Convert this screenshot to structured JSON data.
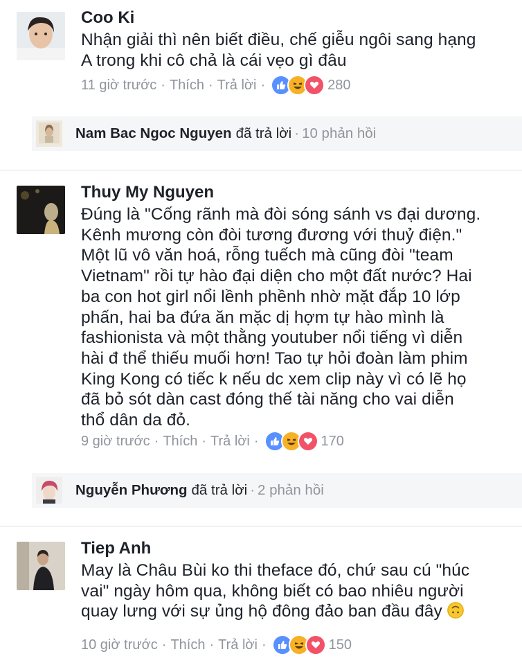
{
  "comments": [
    {
      "name": "Coo Ki",
      "lines": [
        "Nhận giải thì nên biết điều, chế giễu ngôi sang hạng",
        "A trong khi cô chả là cái vẹo gì đâu"
      ],
      "time": "11 giờ trước",
      "like": "Thích",
      "reply": "Trả lời",
      "reaction_count": "280",
      "replies": {
        "name": "Nam Bac Ngoc Nguyen",
        "action": "đã trả lời",
        "count": "10 phản hồi"
      }
    },
    {
      "name": "Thuy My Nguyen",
      "lines": [
        "Đúng là \"Cống rãnh mà đòi sóng sánh vs đại dương.",
        "Kênh mương còn đòi tương đương với thuỷ điện.\"",
        "Một lũ vô văn hoá, rỗng tuếch mà cũng đòi \"team",
        "Vietnam\" rồi tự hào đại diện cho một đất nước? Hai",
        "ba con hot girl nổi lềnh phềnh nhờ mặt đắp 10 lớp",
        "phấn, hai ba đứa ăn mặc dị hợm tự hào mình là",
        "fashionista và một thằng youtuber nổi tiếng vì diễn",
        "hài đ thể thiếu muối hơn! Tao tự hỏi đoàn làm phim",
        "King Kong có tiếc k nếu dc xem clip này vì có lẽ họ",
        "đã bỏ sót dàn cast đóng thế tài năng cho vai diễn",
        "thổ dân da đỏ."
      ],
      "time": "9 giờ trước",
      "like": "Thích",
      "reply": "Trả lời",
      "reaction_count": "170",
      "replies": {
        "name": "Nguyễn Phương",
        "action": "đã trả lời",
        "count": "2 phản hồi"
      }
    },
    {
      "name": "Tiep Anh",
      "lines": [
        "May là Châu Bùi ko thi theface đó, chứ sau cú \"húc",
        "vai\" ngày hôm qua, không biết có bao nhiêu người",
        "quay lưng với sự ủng hộ đông đảo ban đầu đây"
      ],
      "time": "10 giờ trước",
      "like": "Thích",
      "reply": "Trả lời",
      "reaction_count": "150"
    }
  ],
  "separator": "·",
  "icons": {
    "reactions": [
      "like-icon",
      "haha-icon",
      "love-icon"
    ],
    "inline_emoji": "upside-down-face-emoji"
  },
  "colors": {
    "meta_text": "#90949c",
    "like": "#5890ff",
    "haha": "#f7b125",
    "love": "#f25268",
    "reply_bg": "#f5f6f7"
  }
}
